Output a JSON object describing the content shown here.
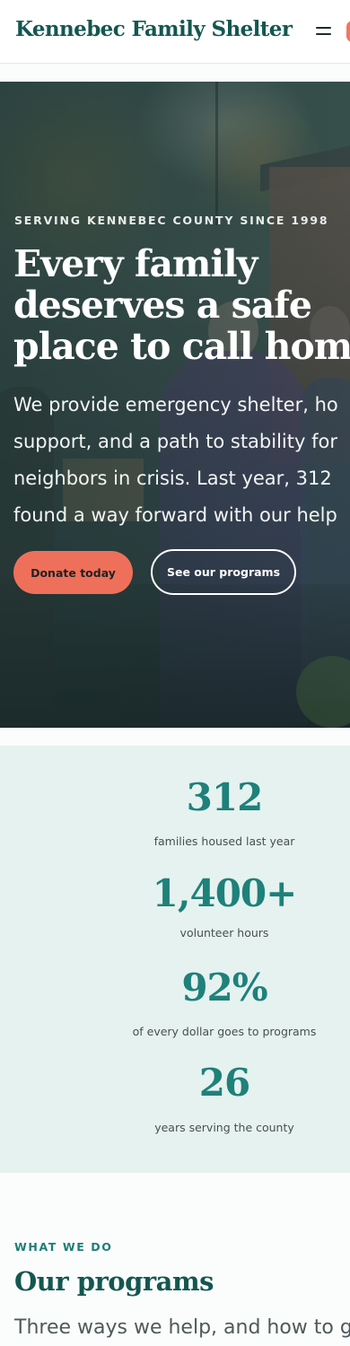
{
  "header": {
    "brand": "Kennebec Family Shelter",
    "menu_icon": "hamburger-menu-icon"
  },
  "hero": {
    "eyebrow": "SERVING KENNEBEC COUNTY SINCE 1998",
    "title_lines": [
      "Every family",
      "deserves a safe",
      "place to call home"
    ],
    "copy_lines": [
      "We provide emergency shelter, ho",
      "support, and a path to stability for",
      "neighbors in crisis. Last year, 312",
      "found a way forward with our help"
    ],
    "primary_button": "Donate today",
    "secondary_button": "See our programs"
  },
  "stats": [
    {
      "value": "312",
      "label": "families housed last year"
    },
    {
      "value": "1,400+",
      "label": "volunteer hours"
    },
    {
      "value": "92%",
      "label": "of every dollar goes to programs"
    },
    {
      "value": "26",
      "label": "years serving the county"
    }
  ],
  "programs": {
    "eyebrow": "WHAT WE DO",
    "title": "Our programs",
    "lead": "Three ways we help, and how to g"
  },
  "colors": {
    "brand_green": "#14574f",
    "accent_coral": "#ef705a",
    "stat_teal": "#1e817a",
    "stats_bg": "#e6f2f0"
  }
}
